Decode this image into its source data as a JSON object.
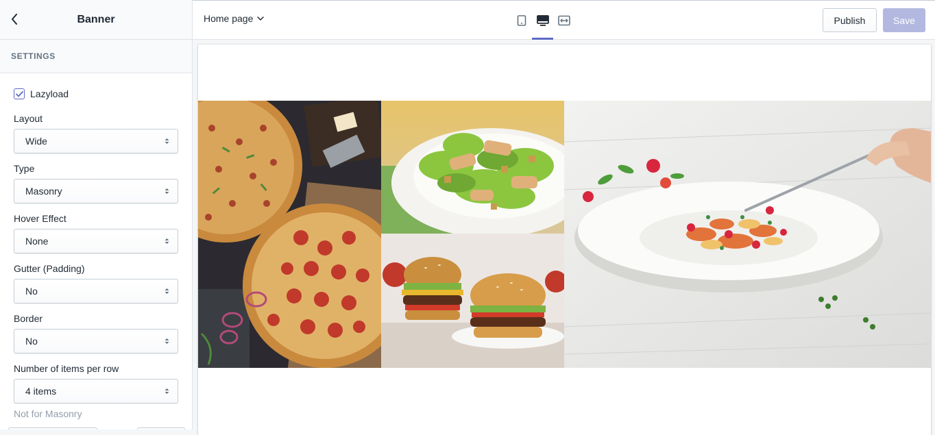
{
  "sidebar": {
    "title": "Banner",
    "section": "SETTINGS",
    "lazyload": {
      "label": "Lazyload",
      "checked": true
    },
    "fields": [
      {
        "label": "Layout",
        "value": "Wide"
      },
      {
        "label": "Type",
        "value": "Masonry"
      },
      {
        "label": "Hover Effect",
        "value": "None"
      },
      {
        "label": "Gutter (Padding)",
        "value": "No"
      },
      {
        "label": "Border",
        "value": "No"
      },
      {
        "label": "Number of items per row",
        "value": "4 items"
      }
    ],
    "help": "Not for Masonry"
  },
  "topbar": {
    "page": "Home page",
    "devices": [
      "mobile-icon",
      "desktop-icon",
      "fullscreen-icon"
    ],
    "active_device": "desktop-icon",
    "publish": "Publish",
    "save": "Save"
  },
  "preview": {
    "images": [
      "pizza",
      "caesar-salad",
      "burgers",
      "pasta-dish"
    ]
  },
  "colors": {
    "accent": "#5c6ac4",
    "save_disabled": "#b3b8e0"
  }
}
